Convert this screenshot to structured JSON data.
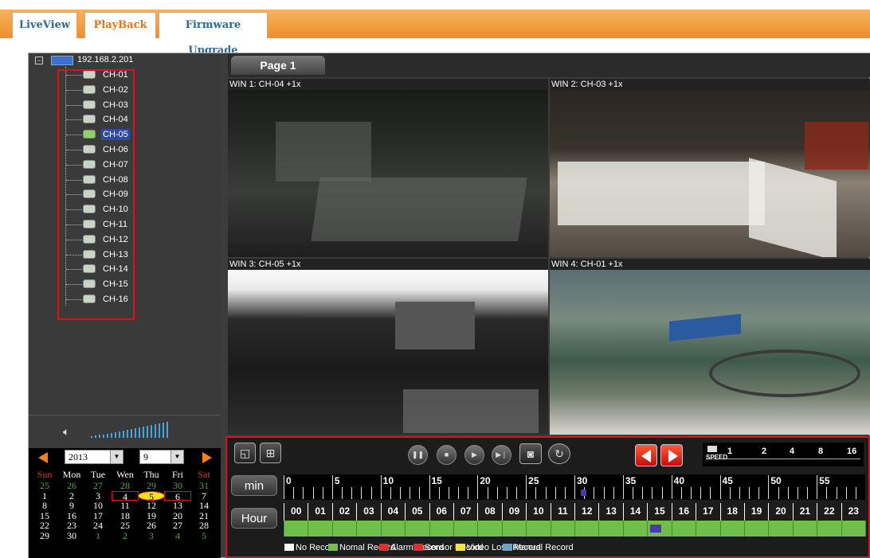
{
  "tabs": [
    {
      "label": "LiveView"
    },
    {
      "label": "PlayBack"
    },
    {
      "label": "Firmware Upgrade"
    }
  ],
  "tree": {
    "root": "192.168.2.201",
    "toggle": "−",
    "channels": [
      "CH-01",
      "CH-02",
      "CH-03",
      "CH-04",
      "CH-05",
      "CH-06",
      "CH-07",
      "CH-08",
      "CH-09",
      "CH-10",
      "CH-11",
      "CH-12",
      "CH-13",
      "CH-14",
      "CH-15",
      "CH-16"
    ],
    "selected": "CH-05"
  },
  "calendar": {
    "year": "2013",
    "month": "9",
    "weekdays": [
      "Sun",
      "Mon",
      "Tue",
      "Wen",
      "Thu",
      "Fri",
      "Sat"
    ],
    "weeks": [
      [
        "25",
        "26",
        "27",
        "28",
        "29",
        "30",
        "31"
      ],
      [
        "1",
        "2",
        "3",
        "4",
        "5",
        "6",
        "7"
      ],
      [
        "8",
        "9",
        "10",
        "11",
        "12",
        "13",
        "14"
      ],
      [
        "15",
        "16",
        "17",
        "18",
        "19",
        "20",
        "21"
      ],
      [
        "22",
        "23",
        "24",
        "25",
        "26",
        "27",
        "28"
      ],
      [
        "29",
        "30",
        "1",
        "2",
        "3",
        "4",
        "5"
      ]
    ],
    "recorded_days": [
      "4",
      "5",
      "6"
    ],
    "selected_day": "5"
  },
  "page_tab": "Page 1",
  "windows": [
    {
      "title": "WIN 1: CH-04 +1x"
    },
    {
      "title": "WIN 2: CH-03 +1x"
    },
    {
      "title": "WIN 3: CH-05 +1x"
    },
    {
      "title": "WIN 4: CH-01 +1x"
    }
  ],
  "controls": {
    "min_label": "min",
    "hour_label": "Hour",
    "speed_label": "SPEED",
    "speeds": [
      "1",
      "2",
      "4",
      "8",
      "16"
    ],
    "minute_ticks": [
      "0",
      "5",
      "10",
      "15",
      "20",
      "25",
      "30",
      "35",
      "40",
      "45",
      "50",
      "55"
    ],
    "hours": [
      "00",
      "01",
      "02",
      "03",
      "04",
      "05",
      "06",
      "07",
      "08",
      "09",
      "10",
      "11",
      "12",
      "13",
      "14",
      "15",
      "16",
      "17",
      "18",
      "19",
      "20",
      "21",
      "22",
      "23"
    ],
    "minute_marker": 31,
    "hour_marker": 15,
    "recorded_hours_from": 0,
    "recorded_hours_to": 24
  },
  "legend": [
    {
      "label": "No Record",
      "color": "#ffffff"
    },
    {
      "label": "Nomal Record",
      "color": "#6fbf4a"
    },
    {
      "label": "Alarm Record",
      "color": "#e0302a"
    },
    {
      "label": "Sensor Record",
      "color": "#e0302a"
    },
    {
      "label": "Video Loss Record",
      "color": "#f2e340"
    },
    {
      "label": "Manual Record",
      "color": "#6fa0c8"
    }
  ],
  "colors": {
    "accent": "#ef8d2a",
    "tab_text": "#2f6a98",
    "record": "#6fbf4a",
    "highlight": "#e0101a"
  }
}
